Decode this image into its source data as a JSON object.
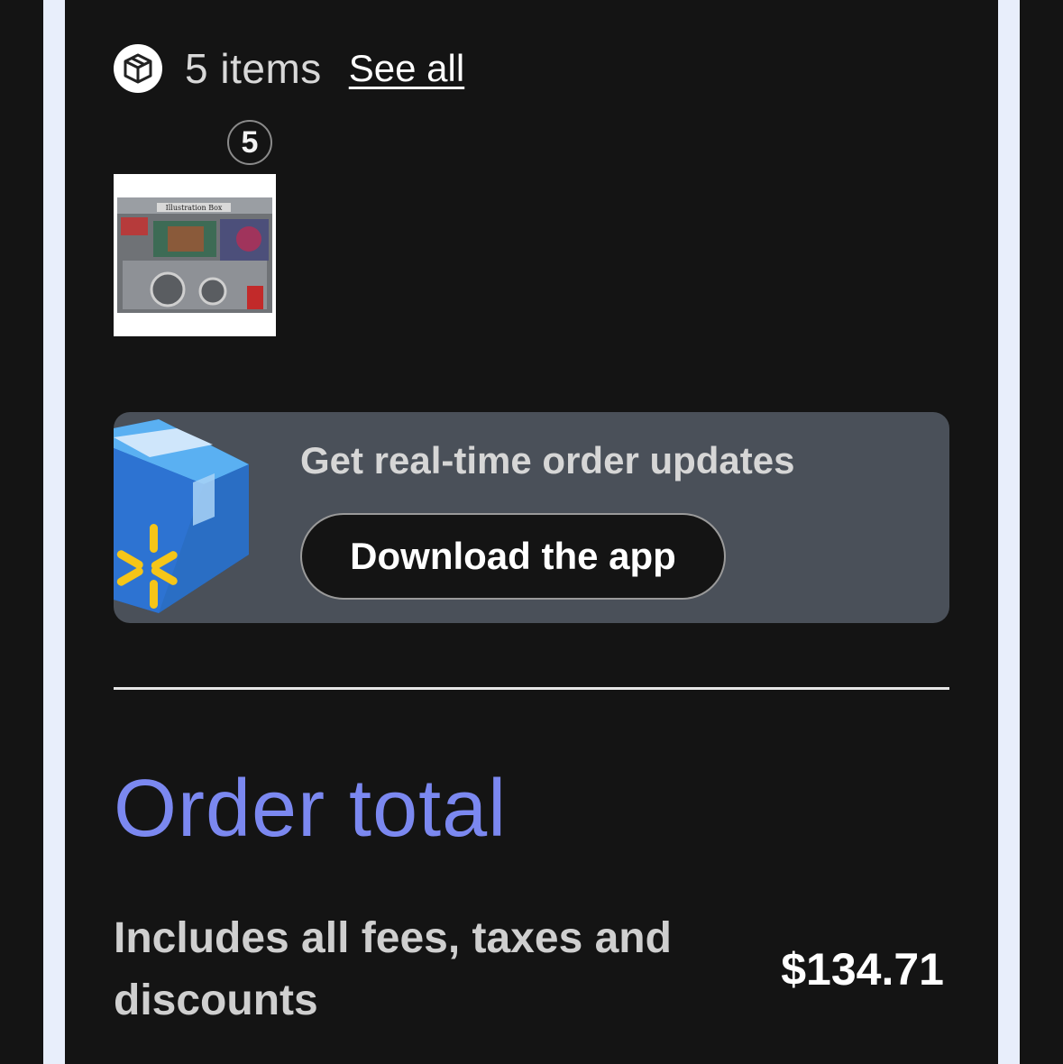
{
  "items_summary": {
    "count_label": "5 items",
    "see_all_label": "See all",
    "icon": "box-icon"
  },
  "item": {
    "quantity_badge": "5",
    "thumbnail_alt": "Illustration Box product image",
    "thumbnail_text": "Illustration Box"
  },
  "promo": {
    "title": "Get real-time order updates",
    "button_label": "Download the app",
    "art": "walmart-box-icon"
  },
  "order_total": {
    "heading": "Order total",
    "note": "Includes all fees, taxes and discounts",
    "amount": "$134.71"
  },
  "colors": {
    "background": "#141414",
    "rail": "#e8eefb",
    "promo_bg": "#4a5059",
    "heading_accent": "#7b88f0",
    "spark_yellow": "#f5c518",
    "box_blue": "#2d73d2"
  }
}
